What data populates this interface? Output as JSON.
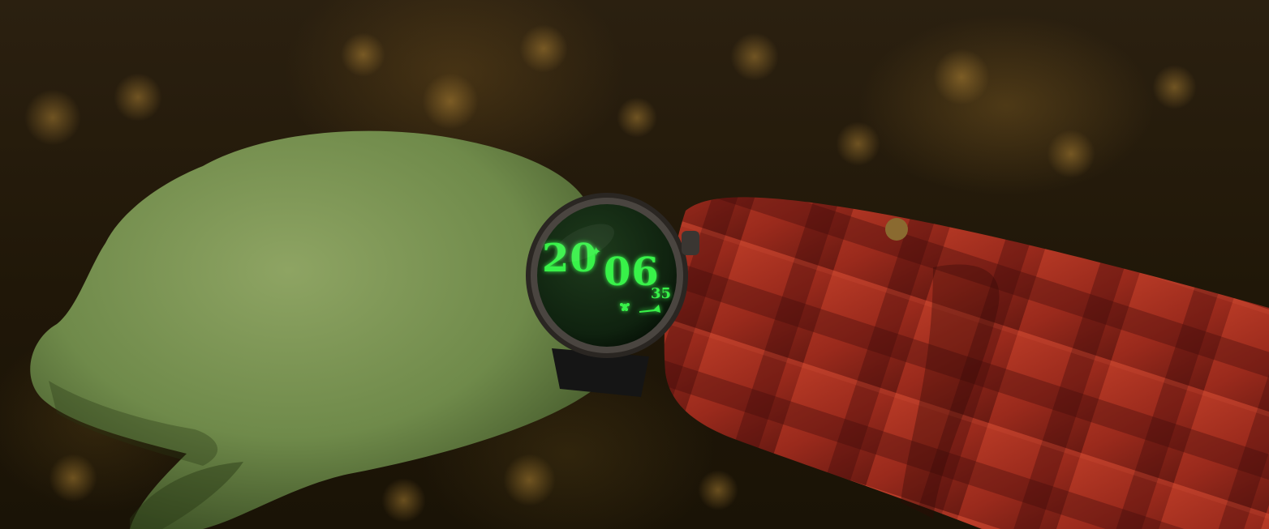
{
  "watch": {
    "hours": "20",
    "minutes": "06",
    "seconds": "35",
    "separator": "✦",
    "display_color": "#39f24a",
    "icons": [
      "flower-icon",
      "trumpet-icon"
    ]
  },
  "palette": {
    "hand": "#6f8a4a",
    "sleeve": "#9a2a1c",
    "background": "#241a0b"
  }
}
